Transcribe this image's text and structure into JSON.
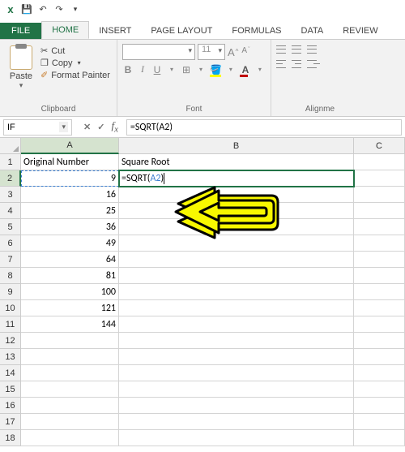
{
  "qat": {
    "save": "💾",
    "undo": "↶",
    "redo": "↷"
  },
  "tabs": {
    "file": "FILE",
    "home": "HOME",
    "insert": "INSERT",
    "page_layout": "PAGE LAYOUT",
    "formulas": "FORMULAS",
    "data": "DATA",
    "review": "REVIEW"
  },
  "ribbon": {
    "clipboard": {
      "label": "Clipboard",
      "paste": "Paste",
      "cut": "Cut",
      "copy": "Copy",
      "format_painter": "Format Painter"
    },
    "font": {
      "label": "Font",
      "name": "",
      "size": "11",
      "bold": "B",
      "italic": "I",
      "underline": "U",
      "grow": "A",
      "shrink": "A"
    },
    "alignment": {
      "label": "Alignme"
    }
  },
  "namebox": "IF",
  "formula_bar": "=SQRT(A2)",
  "columns": {
    "A": "A",
    "B": "B",
    "C": "C"
  },
  "headers": {
    "A": "Original Number",
    "B": "Square Root"
  },
  "active_formula": {
    "prefix": "=SQRT(",
    "ref": "A2",
    "suffix": ")"
  },
  "data_rows": [
    {
      "n": 2,
      "A": "9"
    },
    {
      "n": 3,
      "A": "16"
    },
    {
      "n": 4,
      "A": "25"
    },
    {
      "n": 5,
      "A": "36"
    },
    {
      "n": 6,
      "A": "49"
    },
    {
      "n": 7,
      "A": "64"
    },
    {
      "n": 8,
      "A": "81"
    },
    {
      "n": 9,
      "A": "100"
    },
    {
      "n": 10,
      "A": "121"
    },
    {
      "n": 11,
      "A": "144"
    }
  ],
  "row_numbers": [
    1,
    2,
    3,
    4,
    5,
    6,
    7,
    8,
    9,
    10,
    11,
    12,
    13,
    14,
    15,
    16,
    17,
    18
  ]
}
